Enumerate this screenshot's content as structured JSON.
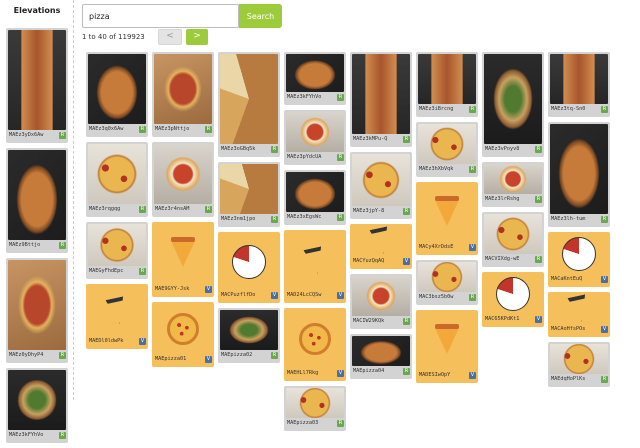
{
  "sidebar": {
    "title": "Elevations",
    "items": [
      {
        "id": "MAEz3yDx6Aw",
        "badge": "R",
        "kind": "photo",
        "style": "p-long",
        "h": 100
      },
      {
        "id": "MAEz9Bttjo",
        "badge": "R",
        "kind": "photo",
        "style": "p-dark",
        "h": 90
      },
      {
        "id": "MAEz0yDhyP4",
        "badge": "R",
        "kind": "photo",
        "style": "p-board",
        "h": 90
      },
      {
        "id": "MAEz3kFYhVo",
        "badge": "R",
        "kind": "photo",
        "style": "p-green",
        "h": 60
      }
    ]
  },
  "search": {
    "value": "pizza",
    "placeholder": "",
    "button_label": "Search"
  },
  "pager": {
    "count_text": "1 to 40 of 119923",
    "prev_label": "<",
    "next_label": ">"
  },
  "colors": {
    "accent": "#9ccc3c",
    "vector_bg": "#f5bf5c",
    "card_bg": "#d3d3d3",
    "badge_raster": "#6aa84f",
    "badge_vector": "#4a6fa5"
  },
  "columns": [
    [
      {
        "id": "MAEz3q0x6Aw",
        "badge": "R",
        "kind": "photo",
        "style": "p-dark",
        "h": 70
      },
      {
        "id": "MAEz3rqgqg",
        "badge": "R",
        "kind": "photo",
        "style": "p-pep",
        "h": 60
      },
      {
        "id": "MAEGyFhdEpc",
        "badge": "R",
        "kind": "photo",
        "style": "p-pep",
        "h": 42
      },
      {
        "id": "MAEDl0ldwPk",
        "badge": "V",
        "kind": "vector",
        "icon": "icon-line",
        "h": 50
      }
    ],
    [
      {
        "id": "MAEz3pNttjo",
        "badge": "R",
        "kind": "photo",
        "style": "p-board",
        "h": 70
      },
      {
        "id": "MAEz3r4nsAM",
        "badge": "R",
        "kind": "photo",
        "style": "p-marg",
        "h": 60
      },
      {
        "id": "MAE9GYY-Jsk",
        "badge": "V",
        "kind": "vector",
        "icon": "icon-slice",
        "h": 60
      },
      {
        "id": "MAEpizza01",
        "badge": "V",
        "kind": "vector",
        "icon": "icon-whole",
        "h": 50
      }
    ],
    [
      {
        "id": "MAEz3oGBq5k",
        "badge": "R",
        "kind": "photo",
        "style": "p-slice",
        "h": 90
      },
      {
        "id": "MAEz3nm1jpo",
        "badge": "R",
        "kind": "photo",
        "style": "p-slice",
        "h": 50
      },
      {
        "id": "MACPuzflfDo",
        "badge": "V",
        "kind": "vector",
        "icon": "icon-outline",
        "h": 56
      },
      {
        "id": "MAEpizza02",
        "badge": "R",
        "kind": "photo",
        "style": "p-green",
        "h": 40
      }
    ],
    [
      {
        "id": "MAEz3kFYhVo",
        "badge": "R",
        "kind": "photo",
        "style": "p-dark",
        "h": 38
      },
      {
        "id": "MAEz3pYdcUA",
        "badge": "R",
        "kind": "photo",
        "style": "p-marg",
        "h": 40
      },
      {
        "id": "MAEz3xEgsWc",
        "badge": "R",
        "kind": "photo",
        "style": "p-dark",
        "h": 40
      },
      {
        "id": "MAD24LcCQSw",
        "badge": "V",
        "kind": "vector",
        "icon": "icon-line",
        "h": 58
      },
      {
        "id": "MAEHLl7Rkg",
        "badge": "V",
        "kind": "vector",
        "icon": "icon-whole",
        "h": 58
      },
      {
        "id": "MAEpizza03",
        "badge": "R",
        "kind": "photo",
        "style": "p-pep",
        "h": 30
      }
    ],
    [
      {
        "id": "MAEz3kMPu-Q",
        "badge": "R",
        "kind": "photo",
        "style": "p-long",
        "h": 80
      },
      {
        "id": "MAEz3jpY-8",
        "badge": "R",
        "kind": "photo",
        "style": "p-pep",
        "h": 52
      },
      {
        "id": "MACYuzQqAQ",
        "badge": "V",
        "kind": "vector",
        "icon": "icon-line",
        "h": 30
      },
      {
        "id": "MACIW29KQk",
        "badge": "R",
        "kind": "photo",
        "style": "p-marg",
        "h": 40
      },
      {
        "id": "MAEpizza04",
        "badge": "R",
        "kind": "photo",
        "style": "p-dark",
        "h": 30
      }
    ],
    [
      {
        "id": "MAEz3iBrcng",
        "badge": "R",
        "kind": "photo",
        "style": "p-long",
        "h": 50
      },
      {
        "id": "MAEz3hXbVqk",
        "badge": "R",
        "kind": "photo",
        "style": "p-pep",
        "h": 40
      },
      {
        "id": "MACy4XrDdsE",
        "badge": "V",
        "kind": "vector",
        "icon": "icon-slice",
        "h": 58
      },
      {
        "id": "MAC3bsz5b0w",
        "badge": "R",
        "kind": "photo",
        "style": "p-pep",
        "h": 30
      },
      {
        "id": "MADESIwOpY",
        "badge": "V",
        "kind": "vector",
        "icon": "icon-slice",
        "h": 58
      }
    ],
    [
      {
        "id": "MAEz3vPoyv8",
        "badge": "R",
        "kind": "photo",
        "style": "p-green",
        "h": 90
      },
      {
        "id": "MAEz3lrRshg",
        "badge": "R",
        "kind": "photo",
        "style": "p-marg",
        "h": 30
      },
      {
        "id": "MACVIXdg-wE",
        "badge": "R",
        "kind": "photo",
        "style": "p-pep",
        "h": 40
      },
      {
        "id": "MAC65KPdKt1",
        "badge": "V",
        "kind": "vector",
        "icon": "icon-outline",
        "h": 40
      }
    ],
    [
      {
        "id": "MAEz3tq-Sn0",
        "badge": "R",
        "kind": "photo",
        "style": "p-long",
        "h": 50
      },
      {
        "id": "MAEz3lh-tum",
        "badge": "R",
        "kind": "photo",
        "style": "p-dark",
        "h": 90
      },
      {
        "id": "MACaKntEuQ",
        "badge": "V",
        "kind": "vector",
        "icon": "icon-outline",
        "h": 40
      },
      {
        "id": "MACAoHfsPOs",
        "badge": "V",
        "kind": "vector",
        "icon": "icon-line",
        "h": 30
      },
      {
        "id": "MAEdqHoPlKs",
        "badge": "R",
        "kind": "photo",
        "style": "p-pep",
        "h": 30
      }
    ]
  ]
}
